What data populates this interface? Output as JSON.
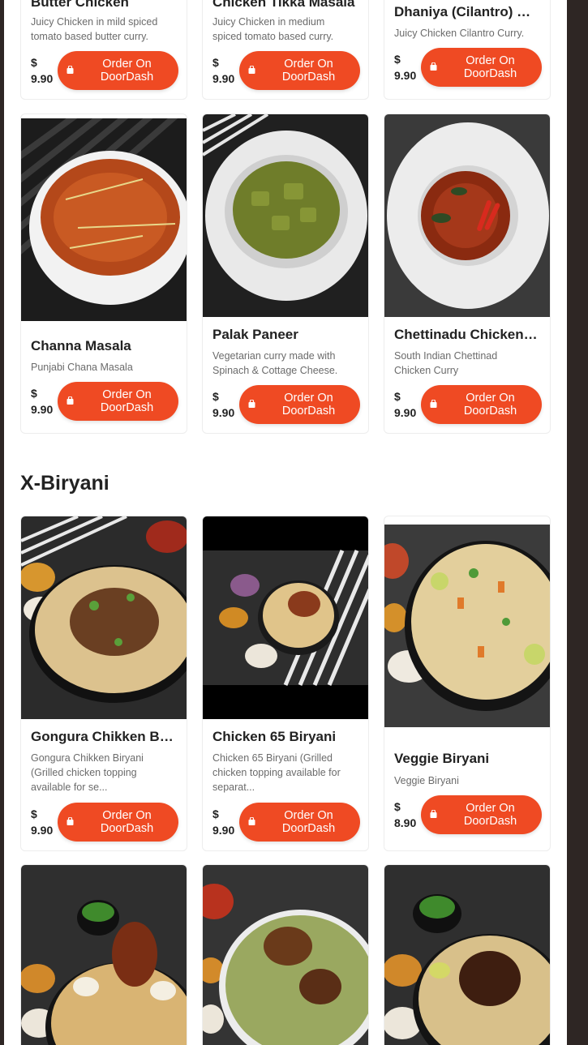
{
  "colors": {
    "accent": "#ef4a23",
    "frame": "#2e2624"
  },
  "sections": [
    {
      "title": "X-Biryani"
    }
  ],
  "currency": "$",
  "items": [
    {
      "name": "Butter Chicken",
      "desc": "Juicy Chicken in mild spiced tomato based butter curry.",
      "price": "9.90",
      "button": "Order On DoorDash",
      "icon": "bag-icon"
    },
    {
      "name": "Chicken Tikka Masala",
      "desc": "Juicy Chicken in medium spiced tomato based curry.",
      "price": "9.90",
      "button": "Order On DoorDash",
      "icon": "bag-icon"
    },
    {
      "name": "Dhaniya (Cilantro) Chicken",
      "desc": "Juicy Chicken Cilantro Curry.",
      "price": "9.90",
      "button": "Order On DoorDash",
      "icon": "bag-icon"
    },
    {
      "name": "Channa Masala",
      "desc": "Punjabi Chana Masala",
      "price": "9.90",
      "button": "Order On DoorDash",
      "icon": "bag-icon"
    },
    {
      "name": "Palak Paneer",
      "desc": "Vegetarian curry made with Spinach & Cottage Cheese.",
      "price": "9.90",
      "button": "Order On DoorDash",
      "icon": "bag-icon"
    },
    {
      "name": "Chettinadu Chicken Curry",
      "desc": "South Indian Chettinad Chicken Curry",
      "price": "9.90",
      "button": "Order On DoorDash",
      "icon": "bag-icon"
    },
    {
      "name": "Gongura Chikken Biryani",
      "desc": "Gongura Chikken Biryani (Grilled chicken topping available for se...",
      "price": "9.90",
      "button": "Order On DoorDash",
      "icon": "bag-icon"
    },
    {
      "name": "Chicken 65 Biryani",
      "desc": "Chicken 65 Biryani (Grilled chicken topping available for separat...",
      "price": "9.90",
      "button": "Order On DoorDash",
      "icon": "bag-icon"
    },
    {
      "name": "Veggie Biryani",
      "desc": "Veggie Biryani",
      "price": "8.90",
      "button": "Order On DoorDash",
      "icon": "bag-icon"
    }
  ]
}
